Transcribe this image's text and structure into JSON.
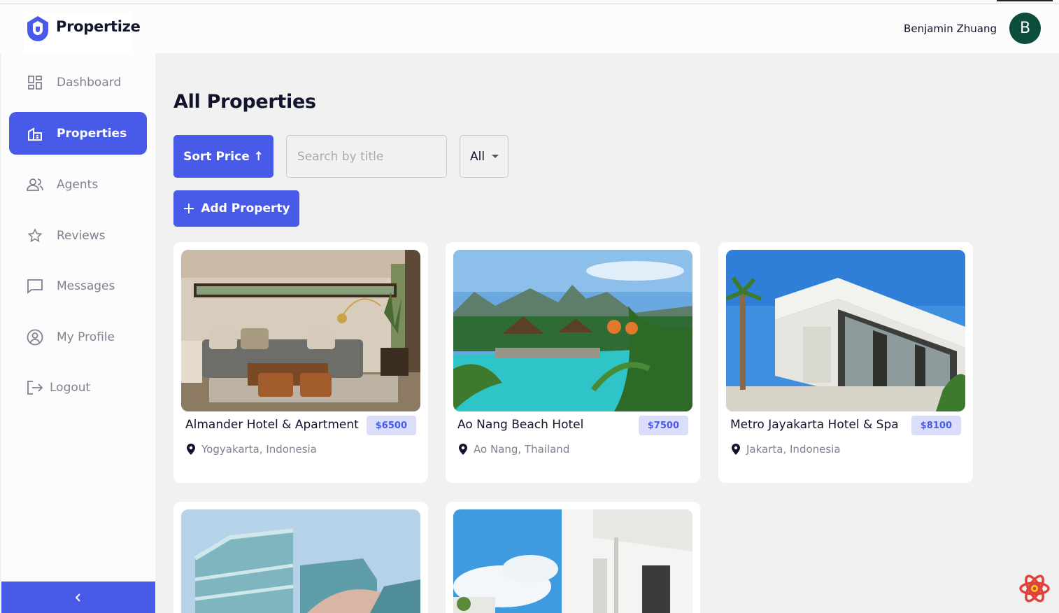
{
  "app": {
    "name": "Propertize"
  },
  "user": {
    "name": "Benjamin Zhuang",
    "initial": "B"
  },
  "sidebar": {
    "items": [
      {
        "label": "Dashboard",
        "icon": "dashboard-icon"
      },
      {
        "label": "Properties",
        "icon": "properties-icon",
        "active": true
      },
      {
        "label": "Agents",
        "icon": "agents-icon"
      },
      {
        "label": "Reviews",
        "icon": "star-icon"
      },
      {
        "label": "Messages",
        "icon": "chat-icon"
      },
      {
        "label": "My Profile",
        "icon": "profile-icon"
      },
      {
        "label": "Logout",
        "icon": "logout-icon"
      }
    ],
    "collapse_icon": "chevron-left-icon"
  },
  "main": {
    "title": "All Properties",
    "sort_label": "Sort Price ↑",
    "search_placeholder": "Search by title",
    "filter_value": "All",
    "add_label": "Add Property"
  },
  "properties": [
    {
      "title": "Almander Hotel & Apartment",
      "price": "$6500",
      "location": "Yogyakarta, Indonesia",
      "image": "living-room"
    },
    {
      "title": "Ao Nang Beach Hotel",
      "price": "$7500",
      "location": "Ao Nang, Thailand",
      "image": "tropical-pool"
    },
    {
      "title": "Metro Jayakarta Hotel & Spa",
      "price": "$8100",
      "location": "Jakarta, Indonesia",
      "image": "white-villa"
    },
    {
      "title": "",
      "price": "",
      "location": "",
      "image": "teal-building"
    },
    {
      "title": "",
      "price": "",
      "location": "",
      "image": "white-apartment"
    }
  ],
  "colors": {
    "accent": "#475be8",
    "price_bg": "#dadefa",
    "avatar": "#0d4d3c",
    "text": "#11142d",
    "muted": "#808191"
  }
}
